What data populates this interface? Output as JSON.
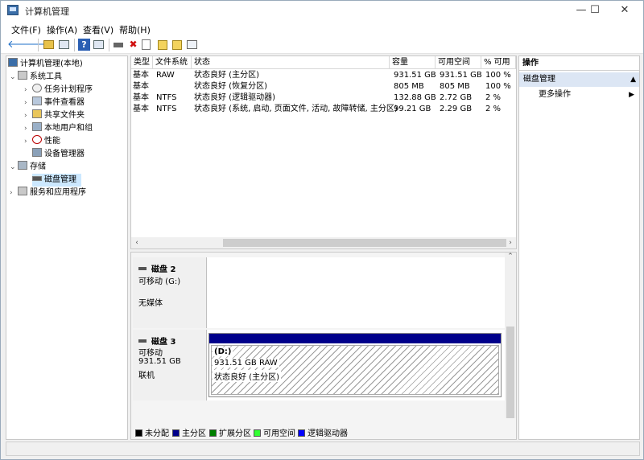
{
  "window": {
    "title": "计算机管理",
    "controls": {
      "minimize": "—",
      "maximize": "☐",
      "close": "✕"
    }
  },
  "menu": [
    "文件(F)",
    "操作(A)",
    "查看(V)",
    "帮助(H)"
  ],
  "toolbar": {
    "back": "🡐",
    "forward": "🡒",
    "help": "?",
    "delete": "✖"
  },
  "tree": {
    "root": "计算机管理(本地)",
    "items": [
      {
        "label": "系统工具"
      },
      {
        "label": "任务计划程序"
      },
      {
        "label": "事件查看器"
      },
      {
        "label": "共享文件夹"
      },
      {
        "label": "本地用户和组"
      },
      {
        "label": "性能"
      },
      {
        "label": "设备管理器"
      },
      {
        "label": "存储"
      },
      {
        "label": "磁盘管理"
      },
      {
        "label": "服务和应用程序"
      }
    ]
  },
  "volumes": {
    "headers": [
      "类型",
      "文件系统",
      "状态",
      "容量",
      "可用空间",
      "% 可用"
    ],
    "rows": [
      [
        "基本",
        "RAW",
        "状态良好 (主分区)",
        "931.51 GB",
        "931.51 GB",
        "100 %"
      ],
      [
        "基本",
        "",
        "状态良好 (恢复分区)",
        "805 MB",
        "805 MB",
        "100 %"
      ],
      [
        "基本",
        "NTFS",
        "状态良好 (逻辑驱动器)",
        "132.88 GB",
        "2.72 GB",
        "2 %"
      ],
      [
        "基本",
        "NTFS",
        "状态良好 (系统, 启动, 页面文件, 活动, 故障转储, 主分区)",
        "99.21 GB",
        "2.29 GB",
        "2 %"
      ]
    ]
  },
  "disks": [
    {
      "name": "磁盘 2",
      "type": "可移动 (G:)",
      "status": "无媒体"
    },
    {
      "name": "磁盘 3",
      "type": "可移动",
      "size": "931.51 GB",
      "state": "联机",
      "partition": {
        "label": "(D:)",
        "size_fs": "931.51 GB RAW",
        "status": "状态良好 (主分区)"
      }
    }
  ],
  "legend": [
    {
      "label": "未分配",
      "color": "#000000"
    },
    {
      "label": "主分区",
      "color": "#00008b"
    },
    {
      "label": "扩展分区",
      "color": "#008000"
    },
    {
      "label": "可用空间",
      "color": "#33ff33"
    },
    {
      "label": "逻辑驱动器",
      "color": "#0000ff"
    }
  ],
  "actions": {
    "header": "操作",
    "section": "磁盘管理",
    "more": "更多操作"
  }
}
